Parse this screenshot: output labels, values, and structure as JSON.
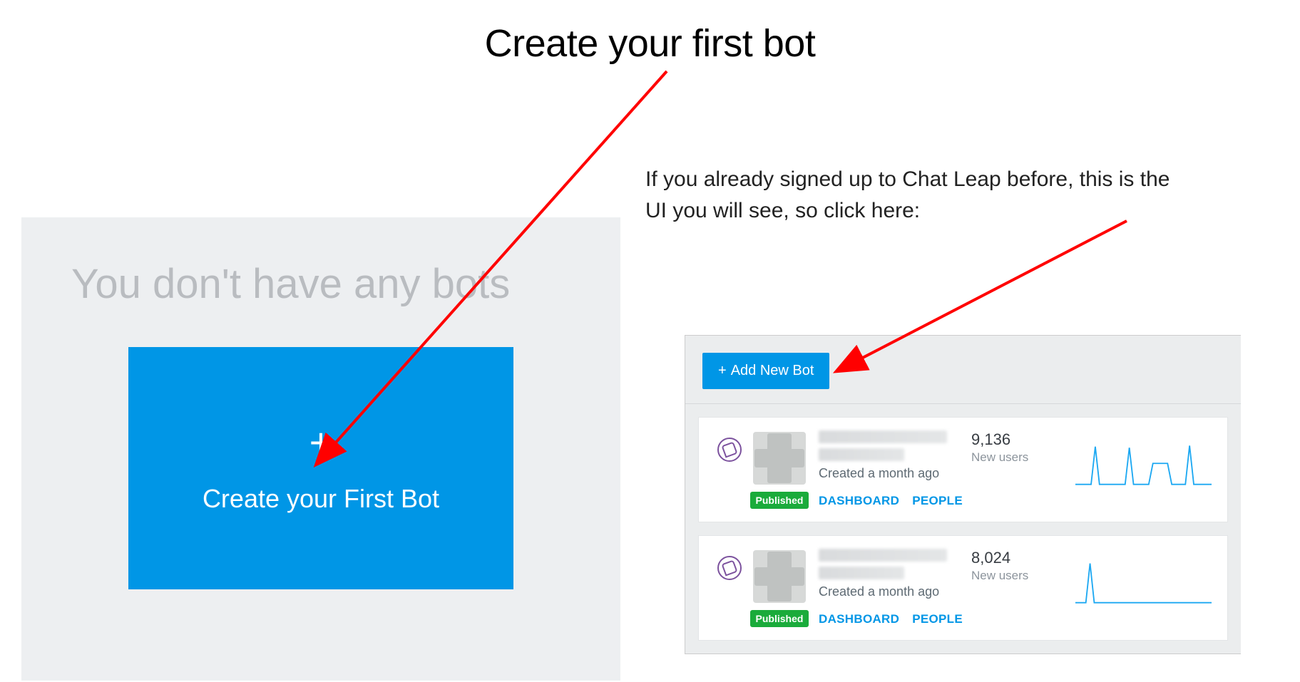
{
  "title": "Create your first bot",
  "left": {
    "empty_text": "You don't have any bots",
    "create_button_label": "Create your First Bot"
  },
  "right": {
    "instruction": "If you already signed up to Chat Leap before, this is the UI you will see, so click here:",
    "add_button_label": "Add New Bot",
    "bots": [
      {
        "created_text": "Created a month ago",
        "badge": "Published",
        "dashboard_label": "DASHBOARD",
        "people_label": "PEOPLE",
        "stat_value": "9,136",
        "stat_label": "New users"
      },
      {
        "created_text": "Created a month ago",
        "badge": "Published",
        "dashboard_label": "DASHBOARD",
        "people_label": "PEOPLE",
        "stat_value": "8,024",
        "stat_label": "New users"
      }
    ]
  },
  "colors": {
    "primary_blue": "#0096e6",
    "green_badge": "#1aab3b",
    "viber_purple": "#7c529e",
    "arrow_red": "#ff0000"
  }
}
